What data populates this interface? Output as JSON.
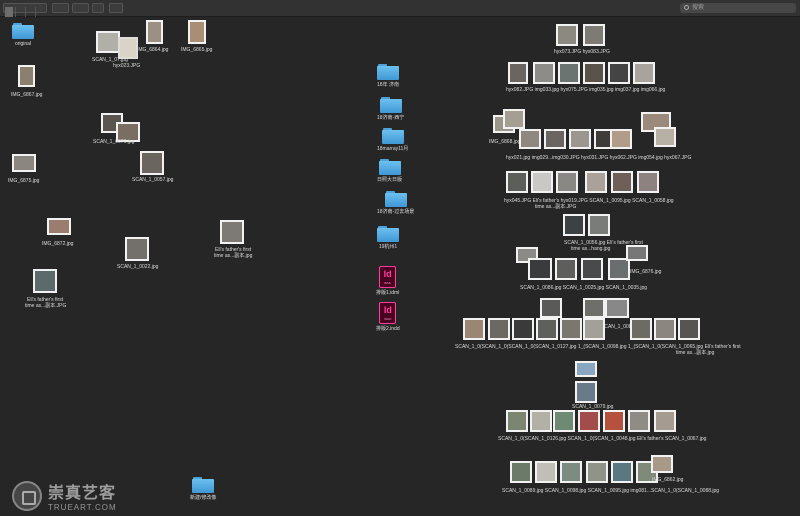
{
  "toolbar": {
    "search_placeholder": "搜索"
  },
  "folders_left": {
    "original": "original",
    "bottom_folder": "新建/修改像"
  },
  "files_left": {
    "img_6867": "IMG_6867.jpg",
    "scan_1_07": "SCAN_1_07.jpg",
    "hyx023": "hyx023.JPG",
    "img_6864": "IMG_6864.jpg",
    "img_6865": "IMG_6865.jpg",
    "scan_1_0070": "SCAN_1_0070.jpg",
    "scan_1_0057": "SCAN_1_0057.jpg",
    "img_6875": "IMG_6875.jpg",
    "img_6872": "IMG_6872.jpg",
    "scan_1_0022": "SCAN_1_0022.jpg",
    "father_a_1": "Eli's father's first",
    "father_a_2": "time as...副本.jpg",
    "father_b_1": "Eli's father's first",
    "father_b_2": "time as...副本.JPG"
  },
  "folders_middle": [
    "18年 济南",
    "18济南-西宁",
    "18marray11月",
    "日照大日版",
    "18济南-过去场景",
    "19杭州1"
  ],
  "indd_files": [
    {
      "name": "排版1.idml",
      "ext": "IDML"
    },
    {
      "name": "排版2.indd",
      "ext": "INDD"
    }
  ],
  "right_labels": [
    "hyx073.JPG hyx083.JPG",
    "hyx082.JPG img033.jpg hyx075.JPG img035.jpg img037.jpg img066.jpg",
    "IMG_6868.jpg",
    "hyx021.jpg img029...img030.JPG hyx031.JPG hyx062.JPG img054.jpg hyx067.JPG",
    "hyx045.JPG Eli's father's hyx019.JPG SCAN_1_0095.jpg SCAN_1_0058.jpg",
    "time as...副本.JPG",
    "SCAN_1_0056.jpg Eli's father's first",
    "time as...hang.jpg",
    "IMG_6876.jpg",
    "SCAN_1_0086.jpg SCAN_1_0025.jpg SCAN_1_0035.jpg",
    "SCAN_1_0083.jpg",
    "SCAN_1_0079.jpg",
    "SCAN_1_0(SCAN_1_0(SCAN_1_0(SCAN_1_0127.jpg 1_(SCAN_1_0098.jpg 1_(SCAN_1_0(SCAN_1_0065.jpg Eli's father's first",
    "time as...副本.jpg",
    "SCAN_1_0(SCAN_1_0126.jpg SCAN_1_0(SCAN_1_0048.jpg Eli's father's SCAN_1_0067.jpg",
    "SCAN_1_0089.jpg SCAN_1_0098.jpg SCAN_1_0095.jpg img081...SCAN_1_0(SCAN_1_0088.jpg",
    "IMG_6862.jpg"
  ],
  "watermark": {
    "cn": "崇真艺客",
    "en": "TRUEART.COM"
  }
}
